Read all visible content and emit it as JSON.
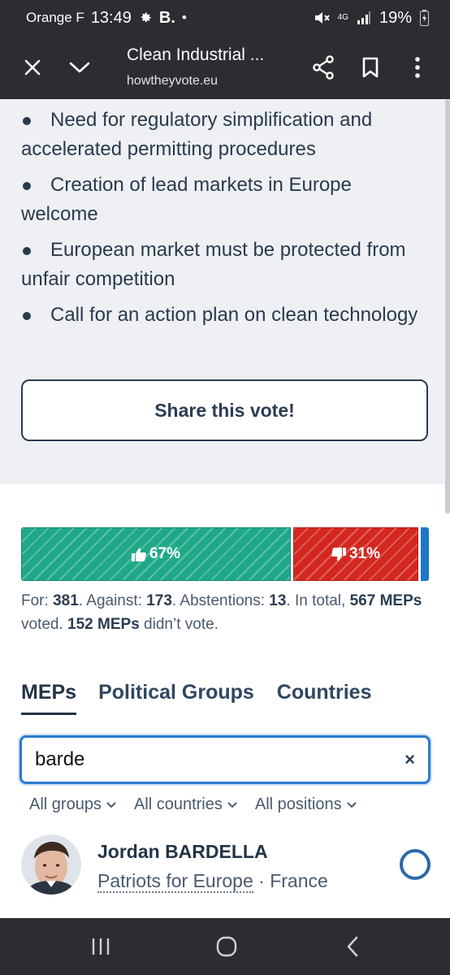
{
  "status_bar": {
    "carrier": "Orange F",
    "time": "13:49",
    "app_badge": "B.",
    "dot": "•",
    "network": "4G",
    "battery": "19%"
  },
  "browser": {
    "title": "Clean Industrial ...",
    "url": "howtheyvote.eu"
  },
  "summary": {
    "items": [
      "Need for regulatory simplification and accelerated permitting procedures",
      "Creation of lead markets in Europe welcome",
      "European market must be protected from unfair competition",
      "Call for an action plan on clean technology"
    ],
    "share_label": "Share this vote!"
  },
  "vote": {
    "for_pct": "67%",
    "against_pct": "31%",
    "for_share": 0.67,
    "against_share": 0.31,
    "for_label": "For: ",
    "for_count": "381",
    "against_label": ". Against: ",
    "against_count": "173",
    "abst_label": ". Abstentions: ",
    "abst_count": "13",
    "total_label": ". In total, ",
    "total_count": "567",
    "voted_label": "MEPs",
    "voted_suffix": " voted. ",
    "nonvote_count": "152 MEPs",
    "nonvote_suffix": " didn’t vote.",
    "colors": {
      "for": "#1fa888",
      "against": "#d3271f",
      "abstain": "#1a78c9"
    }
  },
  "tabs": [
    {
      "label": "MEPs",
      "active": true
    },
    {
      "label": "Political Groups",
      "active": false
    },
    {
      "label": "Countries",
      "active": false
    }
  ],
  "search": {
    "value": "barde",
    "clear": "×"
  },
  "filters": {
    "groups": "All groups",
    "countries": "All countries",
    "positions": "All positions"
  },
  "mep": {
    "name": "Jordan BARDELLA",
    "group": "Patriots for Europe",
    "separator": " · ",
    "country": "France"
  }
}
